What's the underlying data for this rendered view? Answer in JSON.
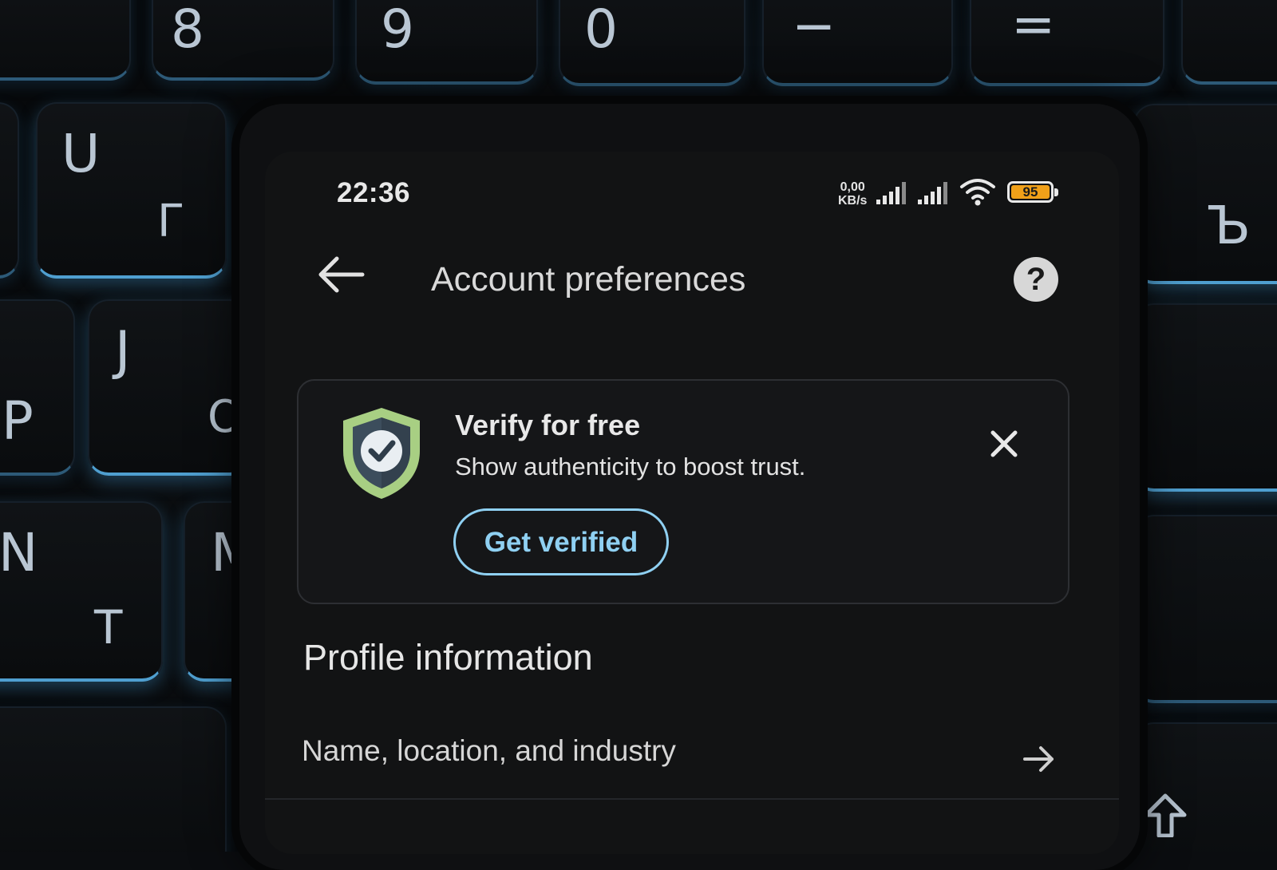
{
  "keyboard": {
    "keys": [
      {
        "main": "8",
        "sub": ""
      },
      {
        "main": "9",
        "sub": ""
      },
      {
        "main": "0",
        "sub": ""
      },
      {
        "main": "−",
        "sub": ""
      },
      {
        "main": "=",
        "sub": ""
      },
      {
        "main": "U",
        "sub": "Г"
      },
      {
        "main": "J",
        "sub": "О"
      },
      {
        "main": "P",
        "sub": ""
      },
      {
        "main": "N",
        "sub": ""
      },
      {
        "main": "M",
        "sub": "Т"
      },
      {
        "main": "Ъ",
        "sub": ""
      }
    ]
  },
  "status_bar": {
    "time": "22:36",
    "net_speed_value": "0,00",
    "net_speed_unit": "KB/s",
    "battery_level": "95",
    "battery_color": "#f0a019"
  },
  "app_bar": {
    "title": "Account preferences",
    "back_icon": "arrow-left-icon",
    "help_icon": "help-icon",
    "help_glyph": "?"
  },
  "verify_card": {
    "title": "Verify for free",
    "subtitle": "Show authenticity to boost trust.",
    "button_label": "Get verified",
    "icon": "shield-check-icon",
    "accent": "#8fd0f2"
  },
  "profile_section": {
    "title": "Profile information",
    "items": [
      {
        "label": "Name, location, and industry",
        "icon": "arrow-right-icon"
      }
    ]
  }
}
